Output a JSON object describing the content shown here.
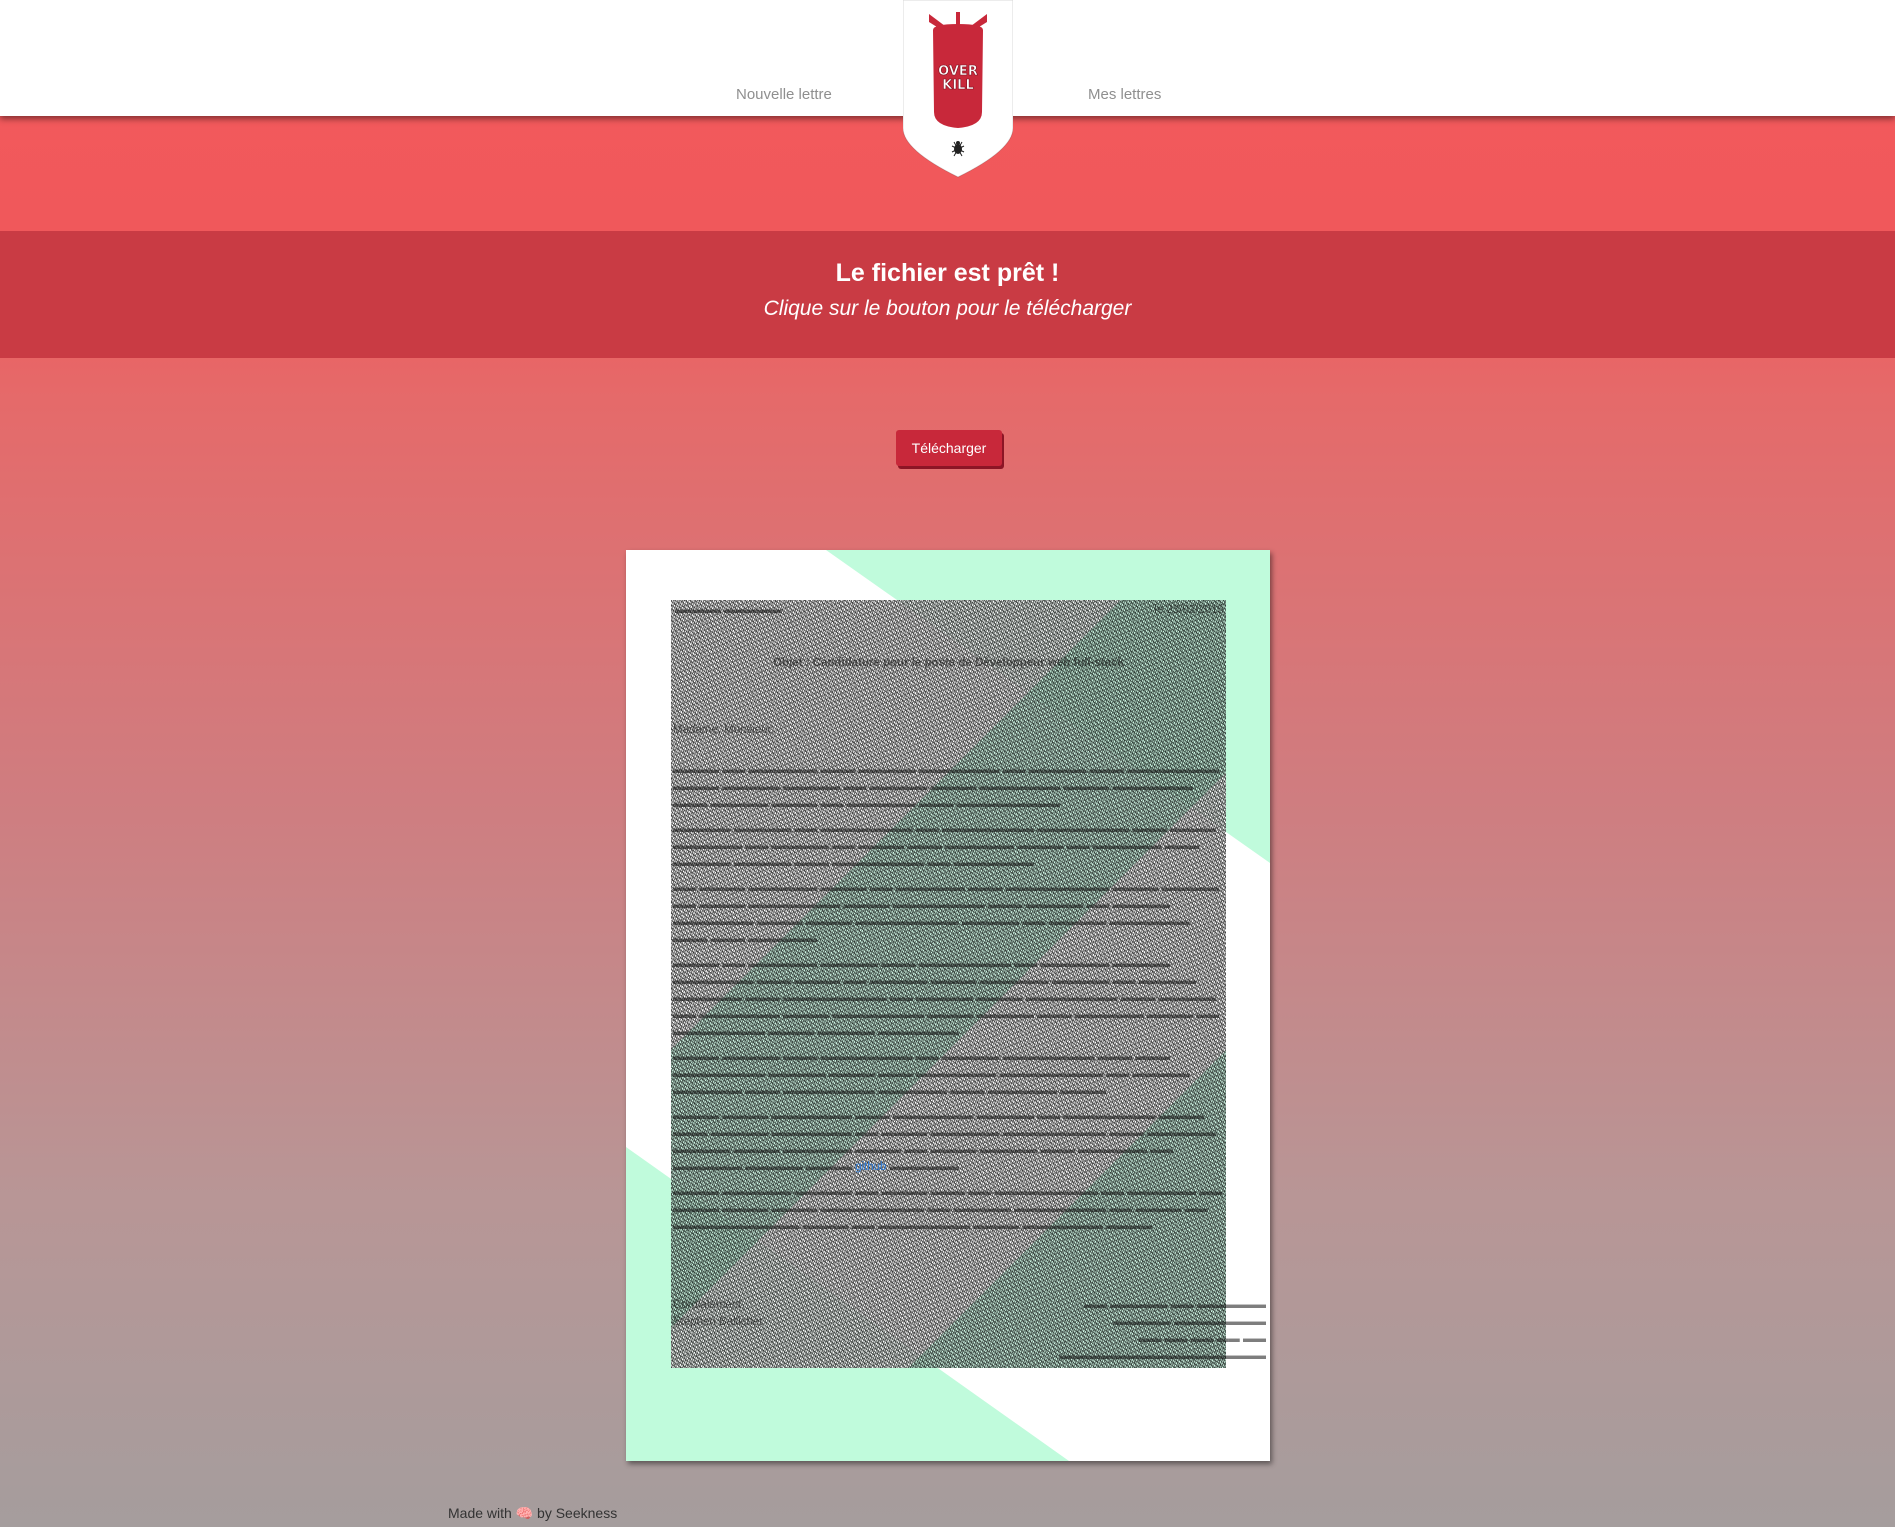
{
  "nav": {
    "new_letter": "Nouvelle lettre",
    "my_letters": "Mes lettres",
    "logo_text_top": "OVER",
    "logo_text_bottom": "KILL"
  },
  "banner": {
    "title": "Le fichier est prêt !",
    "subtitle": "Clique sur le bouton pour le télécharger"
  },
  "download_button": "Télécharger",
  "letter_preview": {
    "date": "le 23/02/2015",
    "object": "Objet : Candidature pour le poste de Développeur web full-stack",
    "salutation": "Madame, Monsieur,",
    "link_text": "github",
    "closing": "Cordialement,",
    "signature": "Stéphen Ballicher"
  },
  "footer": {
    "made_with": "Made with",
    "heart_icon": "brain-icon",
    "by": "by Seekness"
  },
  "colors": {
    "banner": "#c93b44",
    "button": "#c8283a",
    "mint": "#c0fbdc",
    "logo_red": "#c8283a"
  }
}
